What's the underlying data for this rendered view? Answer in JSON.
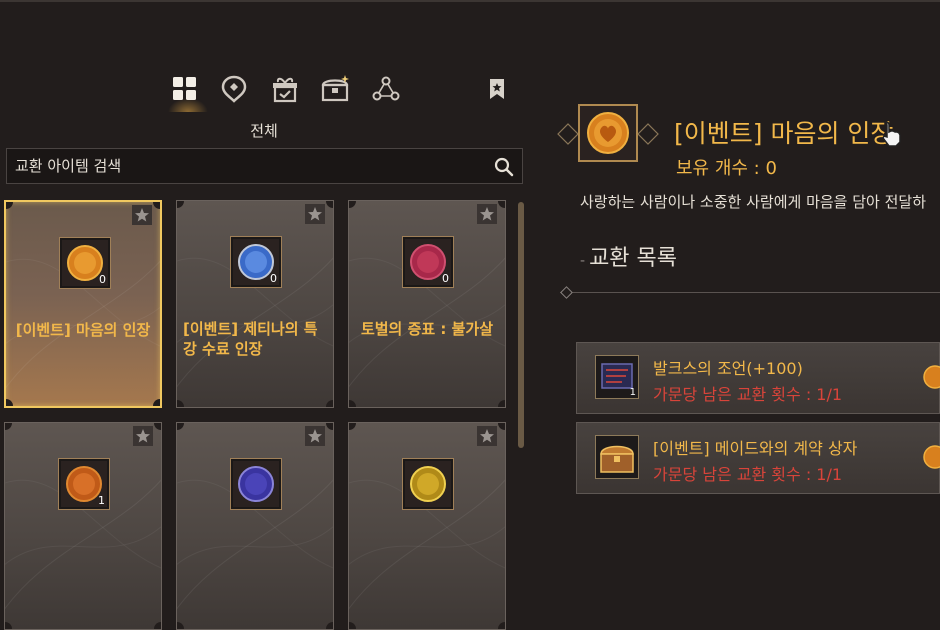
{
  "categories": [
    {
      "icon": "grid-icon",
      "active": true
    },
    {
      "icon": "location-pin-icon",
      "active": false
    },
    {
      "icon": "gift-box-icon",
      "active": false
    },
    {
      "icon": "treasure-chest-icon",
      "active": false
    },
    {
      "icon": "network-nodes-icon",
      "active": false
    },
    {
      "icon": "bookmark-icon",
      "active": false
    }
  ],
  "category_label": "전체",
  "search": {
    "placeholder": "교환 아이템 검색"
  },
  "items": [
    {
      "name": "[이벤트] 마음의 인장",
      "count": "0",
      "icon": "heart-seal-icon",
      "selected": true
    },
    {
      "name": "[이벤트] 제티나의 특강 수료 인장",
      "count": "0",
      "icon": "blue-seal-icon",
      "selected": false
    },
    {
      "name": "토벌의 증표 : 불가살",
      "count": "0",
      "icon": "red-seal-icon",
      "selected": false
    },
    {
      "name": "",
      "count": "1",
      "icon": "orange-seal-icon",
      "selected": false
    },
    {
      "name": "",
      "count": "",
      "icon": "purple-seal-icon",
      "selected": false
    },
    {
      "name": "",
      "count": "",
      "icon": "gold-seal-icon",
      "selected": false
    }
  ],
  "detail": {
    "title": "[이벤트] 마음의 인장",
    "owned": "보유 개수 : 0",
    "description": "사랑하는 사람이나 소중한 사람에게 마음을 담아 전달하",
    "exchange_header": "교환 목록"
  },
  "exchange_list": [
    {
      "name": "발크스의 조언(+100)",
      "limit": "가문당 남은 교환 횟수 : 1/1",
      "count": "1",
      "icon": "scroll-icon"
    },
    {
      "name": "[이벤트] 메이드와의 계약 상자",
      "limit": "가문당 남은 교환 횟수 : 1/1",
      "count": "",
      "icon": "chest-icon"
    }
  ],
  "colors": {
    "accent": "#f2b84a",
    "limit_red": "#d8443a",
    "background": "#221d1c"
  }
}
